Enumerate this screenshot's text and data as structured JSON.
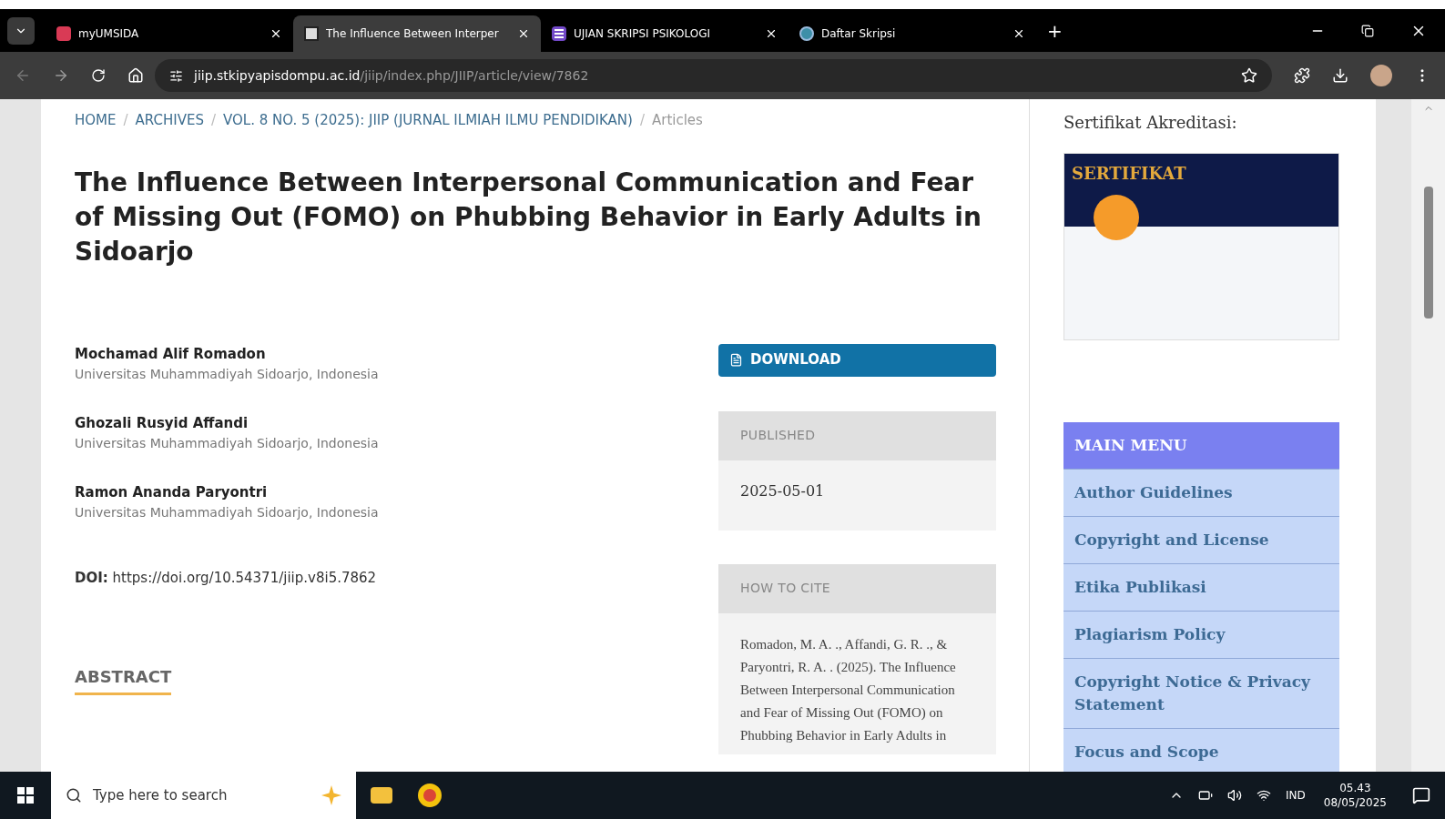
{
  "tabs": [
    {
      "title": "myUMSIDA",
      "selected": false,
      "kind": "umsida"
    },
    {
      "title": "The Influence Between Interper",
      "selected": true,
      "kind": "jiip"
    },
    {
      "title": "UJIAN SKRIPSI PSIKOLOGI",
      "selected": false,
      "kind": "forms"
    },
    {
      "title": "Daftar Skripsi",
      "selected": false,
      "kind": "globe"
    }
  ],
  "new_tab": "+",
  "address": {
    "host": "jiip.stkipyapisdompu.ac.id",
    "path": "/jiip/index.php/JIIP/article/view/7862"
  },
  "breadcrumb": [
    "HOME",
    "ARCHIVES",
    "VOL. 8 NO. 5 (2025): JIIP (JURNAL ILMIAH ILMU PENDIDIKAN)"
  ],
  "breadcrumb_current": "Articles",
  "breadcrumb_separator": "/",
  "title": "The Influence Between Interpersonal Communication and Fear of Missing Out (FOMO) on Phubbing Behavior in Early Adults in Sidoarjo",
  "authors": [
    {
      "name": "Mochamad Alif Romadon",
      "affiliation": "Universitas Muhammadiyah Sidoarjo, Indonesia"
    },
    {
      "name": "Ghozali Rusyid Affandi",
      "affiliation": "Universitas Muhammadiyah Sidoarjo, Indonesia"
    },
    {
      "name": "Ramon Ananda Paryontri",
      "affiliation": "Universitas Muhammadiyah Sidoarjo, Indonesia"
    }
  ],
  "doi": {
    "label": "DOI:",
    "link": "https://doi.org/10.54371/jiip.v8i5.7862"
  },
  "abstract_heading": "ABSTRACT",
  "download": "DOWNLOAD",
  "published": {
    "heading": "PUBLISHED",
    "date": "2025-05-01"
  },
  "cite": {
    "heading": "HOW TO CITE",
    "text": "Romadon, M. A. ., Affandi, G. R. ., & Paryontri, R. A. . (2025). The Influence Between Interpersonal Communication and Fear of Missing Out (FOMO) on Phubbing Behavior in Early Adults in"
  },
  "sidebar": {
    "cert_heading": "Sertifikat Akreditasi:",
    "cert_title": "SERTIFIKAT",
    "menu_heading": "MAIN MENU",
    "menu": [
      "Author Guidelines",
      "Copyright and License",
      "Etika Publikasi",
      "Plagiarism Policy",
      "Copyright Notice & Privacy Statement",
      "Focus and Scope"
    ]
  },
  "taskbar": {
    "search_placeholder": "Type here to search",
    "lang": "IND",
    "time": "05.43",
    "date": "08/05/2025"
  }
}
